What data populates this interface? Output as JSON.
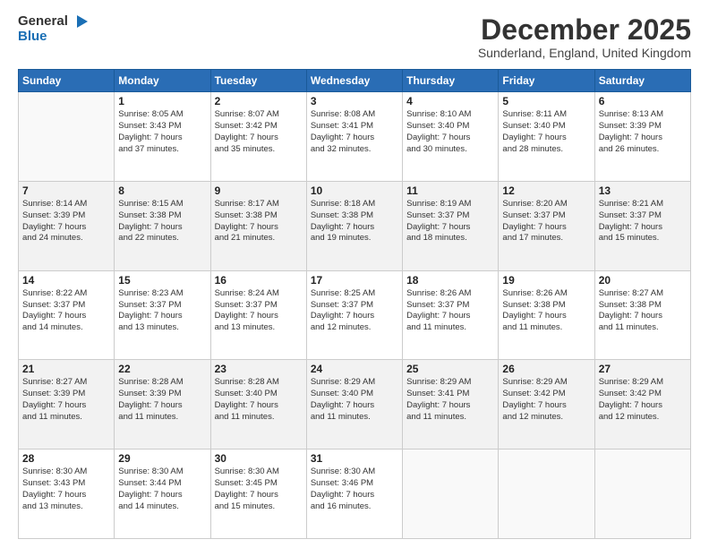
{
  "header": {
    "logo_line1": "General",
    "logo_line2": "Blue",
    "month": "December 2025",
    "location": "Sunderland, England, United Kingdom"
  },
  "weekdays": [
    "Sunday",
    "Monday",
    "Tuesday",
    "Wednesday",
    "Thursday",
    "Friday",
    "Saturday"
  ],
  "weeks": [
    [
      {
        "day": "",
        "info": ""
      },
      {
        "day": "1",
        "info": "Sunrise: 8:05 AM\nSunset: 3:43 PM\nDaylight: 7 hours\nand 37 minutes."
      },
      {
        "day": "2",
        "info": "Sunrise: 8:07 AM\nSunset: 3:42 PM\nDaylight: 7 hours\nand 35 minutes."
      },
      {
        "day": "3",
        "info": "Sunrise: 8:08 AM\nSunset: 3:41 PM\nDaylight: 7 hours\nand 32 minutes."
      },
      {
        "day": "4",
        "info": "Sunrise: 8:10 AM\nSunset: 3:40 PM\nDaylight: 7 hours\nand 30 minutes."
      },
      {
        "day": "5",
        "info": "Sunrise: 8:11 AM\nSunset: 3:40 PM\nDaylight: 7 hours\nand 28 minutes."
      },
      {
        "day": "6",
        "info": "Sunrise: 8:13 AM\nSunset: 3:39 PM\nDaylight: 7 hours\nand 26 minutes."
      }
    ],
    [
      {
        "day": "7",
        "info": "Sunrise: 8:14 AM\nSunset: 3:39 PM\nDaylight: 7 hours\nand 24 minutes."
      },
      {
        "day": "8",
        "info": "Sunrise: 8:15 AM\nSunset: 3:38 PM\nDaylight: 7 hours\nand 22 minutes."
      },
      {
        "day": "9",
        "info": "Sunrise: 8:17 AM\nSunset: 3:38 PM\nDaylight: 7 hours\nand 21 minutes."
      },
      {
        "day": "10",
        "info": "Sunrise: 8:18 AM\nSunset: 3:38 PM\nDaylight: 7 hours\nand 19 minutes."
      },
      {
        "day": "11",
        "info": "Sunrise: 8:19 AM\nSunset: 3:37 PM\nDaylight: 7 hours\nand 18 minutes."
      },
      {
        "day": "12",
        "info": "Sunrise: 8:20 AM\nSunset: 3:37 PM\nDaylight: 7 hours\nand 17 minutes."
      },
      {
        "day": "13",
        "info": "Sunrise: 8:21 AM\nSunset: 3:37 PM\nDaylight: 7 hours\nand 15 minutes."
      }
    ],
    [
      {
        "day": "14",
        "info": "Sunrise: 8:22 AM\nSunset: 3:37 PM\nDaylight: 7 hours\nand 14 minutes."
      },
      {
        "day": "15",
        "info": "Sunrise: 8:23 AM\nSunset: 3:37 PM\nDaylight: 7 hours\nand 13 minutes."
      },
      {
        "day": "16",
        "info": "Sunrise: 8:24 AM\nSunset: 3:37 PM\nDaylight: 7 hours\nand 13 minutes."
      },
      {
        "day": "17",
        "info": "Sunrise: 8:25 AM\nSunset: 3:37 PM\nDaylight: 7 hours\nand 12 minutes."
      },
      {
        "day": "18",
        "info": "Sunrise: 8:26 AM\nSunset: 3:37 PM\nDaylight: 7 hours\nand 11 minutes."
      },
      {
        "day": "19",
        "info": "Sunrise: 8:26 AM\nSunset: 3:38 PM\nDaylight: 7 hours\nand 11 minutes."
      },
      {
        "day": "20",
        "info": "Sunrise: 8:27 AM\nSunset: 3:38 PM\nDaylight: 7 hours\nand 11 minutes."
      }
    ],
    [
      {
        "day": "21",
        "info": "Sunrise: 8:27 AM\nSunset: 3:39 PM\nDaylight: 7 hours\nand 11 minutes."
      },
      {
        "day": "22",
        "info": "Sunrise: 8:28 AM\nSunset: 3:39 PM\nDaylight: 7 hours\nand 11 minutes."
      },
      {
        "day": "23",
        "info": "Sunrise: 8:28 AM\nSunset: 3:40 PM\nDaylight: 7 hours\nand 11 minutes."
      },
      {
        "day": "24",
        "info": "Sunrise: 8:29 AM\nSunset: 3:40 PM\nDaylight: 7 hours\nand 11 minutes."
      },
      {
        "day": "25",
        "info": "Sunrise: 8:29 AM\nSunset: 3:41 PM\nDaylight: 7 hours\nand 11 minutes."
      },
      {
        "day": "26",
        "info": "Sunrise: 8:29 AM\nSunset: 3:42 PM\nDaylight: 7 hours\nand 12 minutes."
      },
      {
        "day": "27",
        "info": "Sunrise: 8:29 AM\nSunset: 3:42 PM\nDaylight: 7 hours\nand 12 minutes."
      }
    ],
    [
      {
        "day": "28",
        "info": "Sunrise: 8:30 AM\nSunset: 3:43 PM\nDaylight: 7 hours\nand 13 minutes."
      },
      {
        "day": "29",
        "info": "Sunrise: 8:30 AM\nSunset: 3:44 PM\nDaylight: 7 hours\nand 14 minutes."
      },
      {
        "day": "30",
        "info": "Sunrise: 8:30 AM\nSunset: 3:45 PM\nDaylight: 7 hours\nand 15 minutes."
      },
      {
        "day": "31",
        "info": "Sunrise: 8:30 AM\nSunset: 3:46 PM\nDaylight: 7 hours\nand 16 minutes."
      },
      {
        "day": "",
        "info": ""
      },
      {
        "day": "",
        "info": ""
      },
      {
        "day": "",
        "info": ""
      }
    ]
  ]
}
